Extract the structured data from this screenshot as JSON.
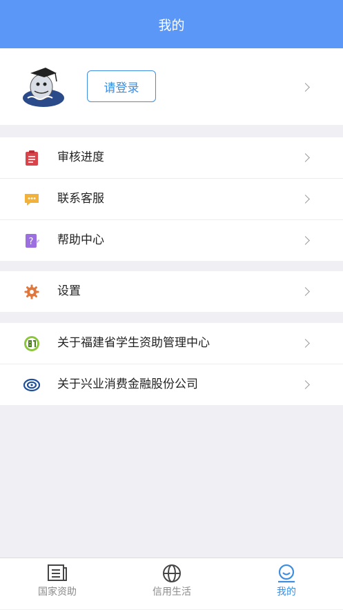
{
  "header": {
    "title": "我的"
  },
  "profile": {
    "login_label": "请登录"
  },
  "menu1": [
    {
      "label": "审核进度",
      "icon": "clipboard-icon"
    },
    {
      "label": "联系客服",
      "icon": "chat-bubble-icon"
    },
    {
      "label": "帮助中心",
      "icon": "help-note-icon"
    }
  ],
  "menu2": [
    {
      "label": "设置",
      "icon": "gear-icon"
    }
  ],
  "menu3": [
    {
      "label": "关于福建省学生资助管理中心",
      "icon": "fujian-aid-logo-icon"
    },
    {
      "label": "关于兴业消费金融股份公司",
      "icon": "cib-logo-icon"
    }
  ],
  "tabbar": {
    "tabs": [
      {
        "label": "国家资助",
        "icon": "book-icon",
        "active": false
      },
      {
        "label": "信用生活",
        "icon": "globe-icon",
        "active": false
      },
      {
        "label": "我的",
        "icon": "smiley-icon",
        "active": true
      }
    ]
  },
  "colors": {
    "primary": "#5b97f6",
    "accent": "#3d8ee0",
    "background": "#efeff4"
  }
}
